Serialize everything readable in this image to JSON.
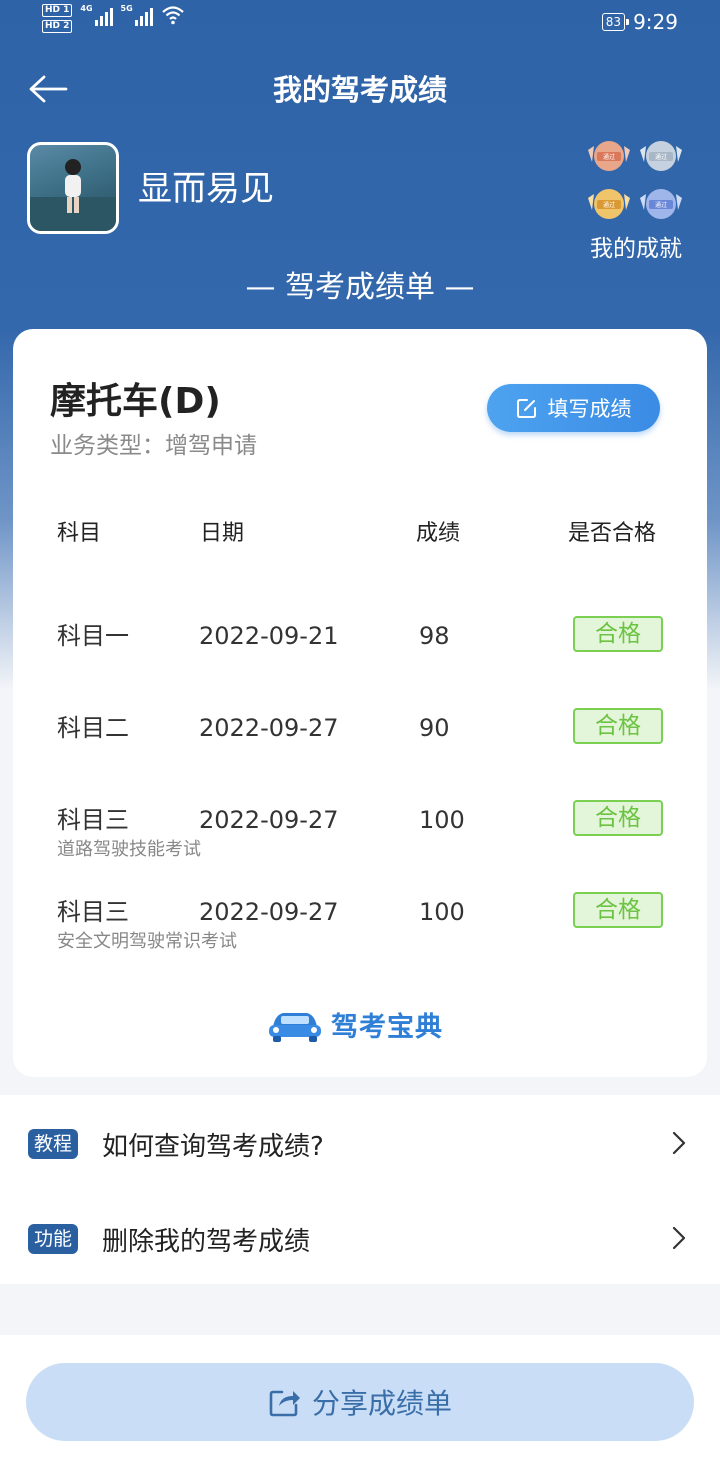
{
  "status_bar": {
    "hd1": "HD 1",
    "hd2": "HD 2",
    "net1": "4G",
    "net2": "5G",
    "battery": "83",
    "time": "9:29"
  },
  "nav": {
    "title": "我的驾考成绩",
    "back_icon": "arrow-left-icon"
  },
  "profile": {
    "username": "显而易见",
    "achievements_label": "我的成就",
    "badge_text": "通过"
  },
  "report_title": "— 驾考成绩单 —",
  "card": {
    "vehicle_class": "摩托车(D)",
    "business_type": "业务类型：增驾申请",
    "fill_button": "填写成绩",
    "headers": {
      "subject": "科目",
      "date": "日期",
      "score": "成绩",
      "passed": "是否合格"
    },
    "rows": [
      {
        "subject": "科目一",
        "date": "2022-09-21",
        "score": "98",
        "status": "合格",
        "sub": ""
      },
      {
        "subject": "科目二",
        "date": "2022-09-27",
        "score": "90",
        "status": "合格",
        "sub": ""
      },
      {
        "subject": "科目三",
        "date": "2022-09-27",
        "score": "100",
        "status": "合格",
        "sub": "道路驾驶技能考试"
      },
      {
        "subject": "科目三",
        "date": "2022-09-27",
        "score": "100",
        "status": "合格",
        "sub": "安全文明驾驶常识考试"
      }
    ],
    "brand": "驾考宝典"
  },
  "list": [
    {
      "tag": "教程",
      "text": "如何查询驾考成绩?"
    },
    {
      "tag": "功能",
      "text": "删除我的驾考成绩"
    }
  ],
  "share_button": "分享成绩单",
  "colors": {
    "primary": "#3468ac",
    "pass_green": "#6cc343",
    "button_blue": "#3a8be4"
  }
}
